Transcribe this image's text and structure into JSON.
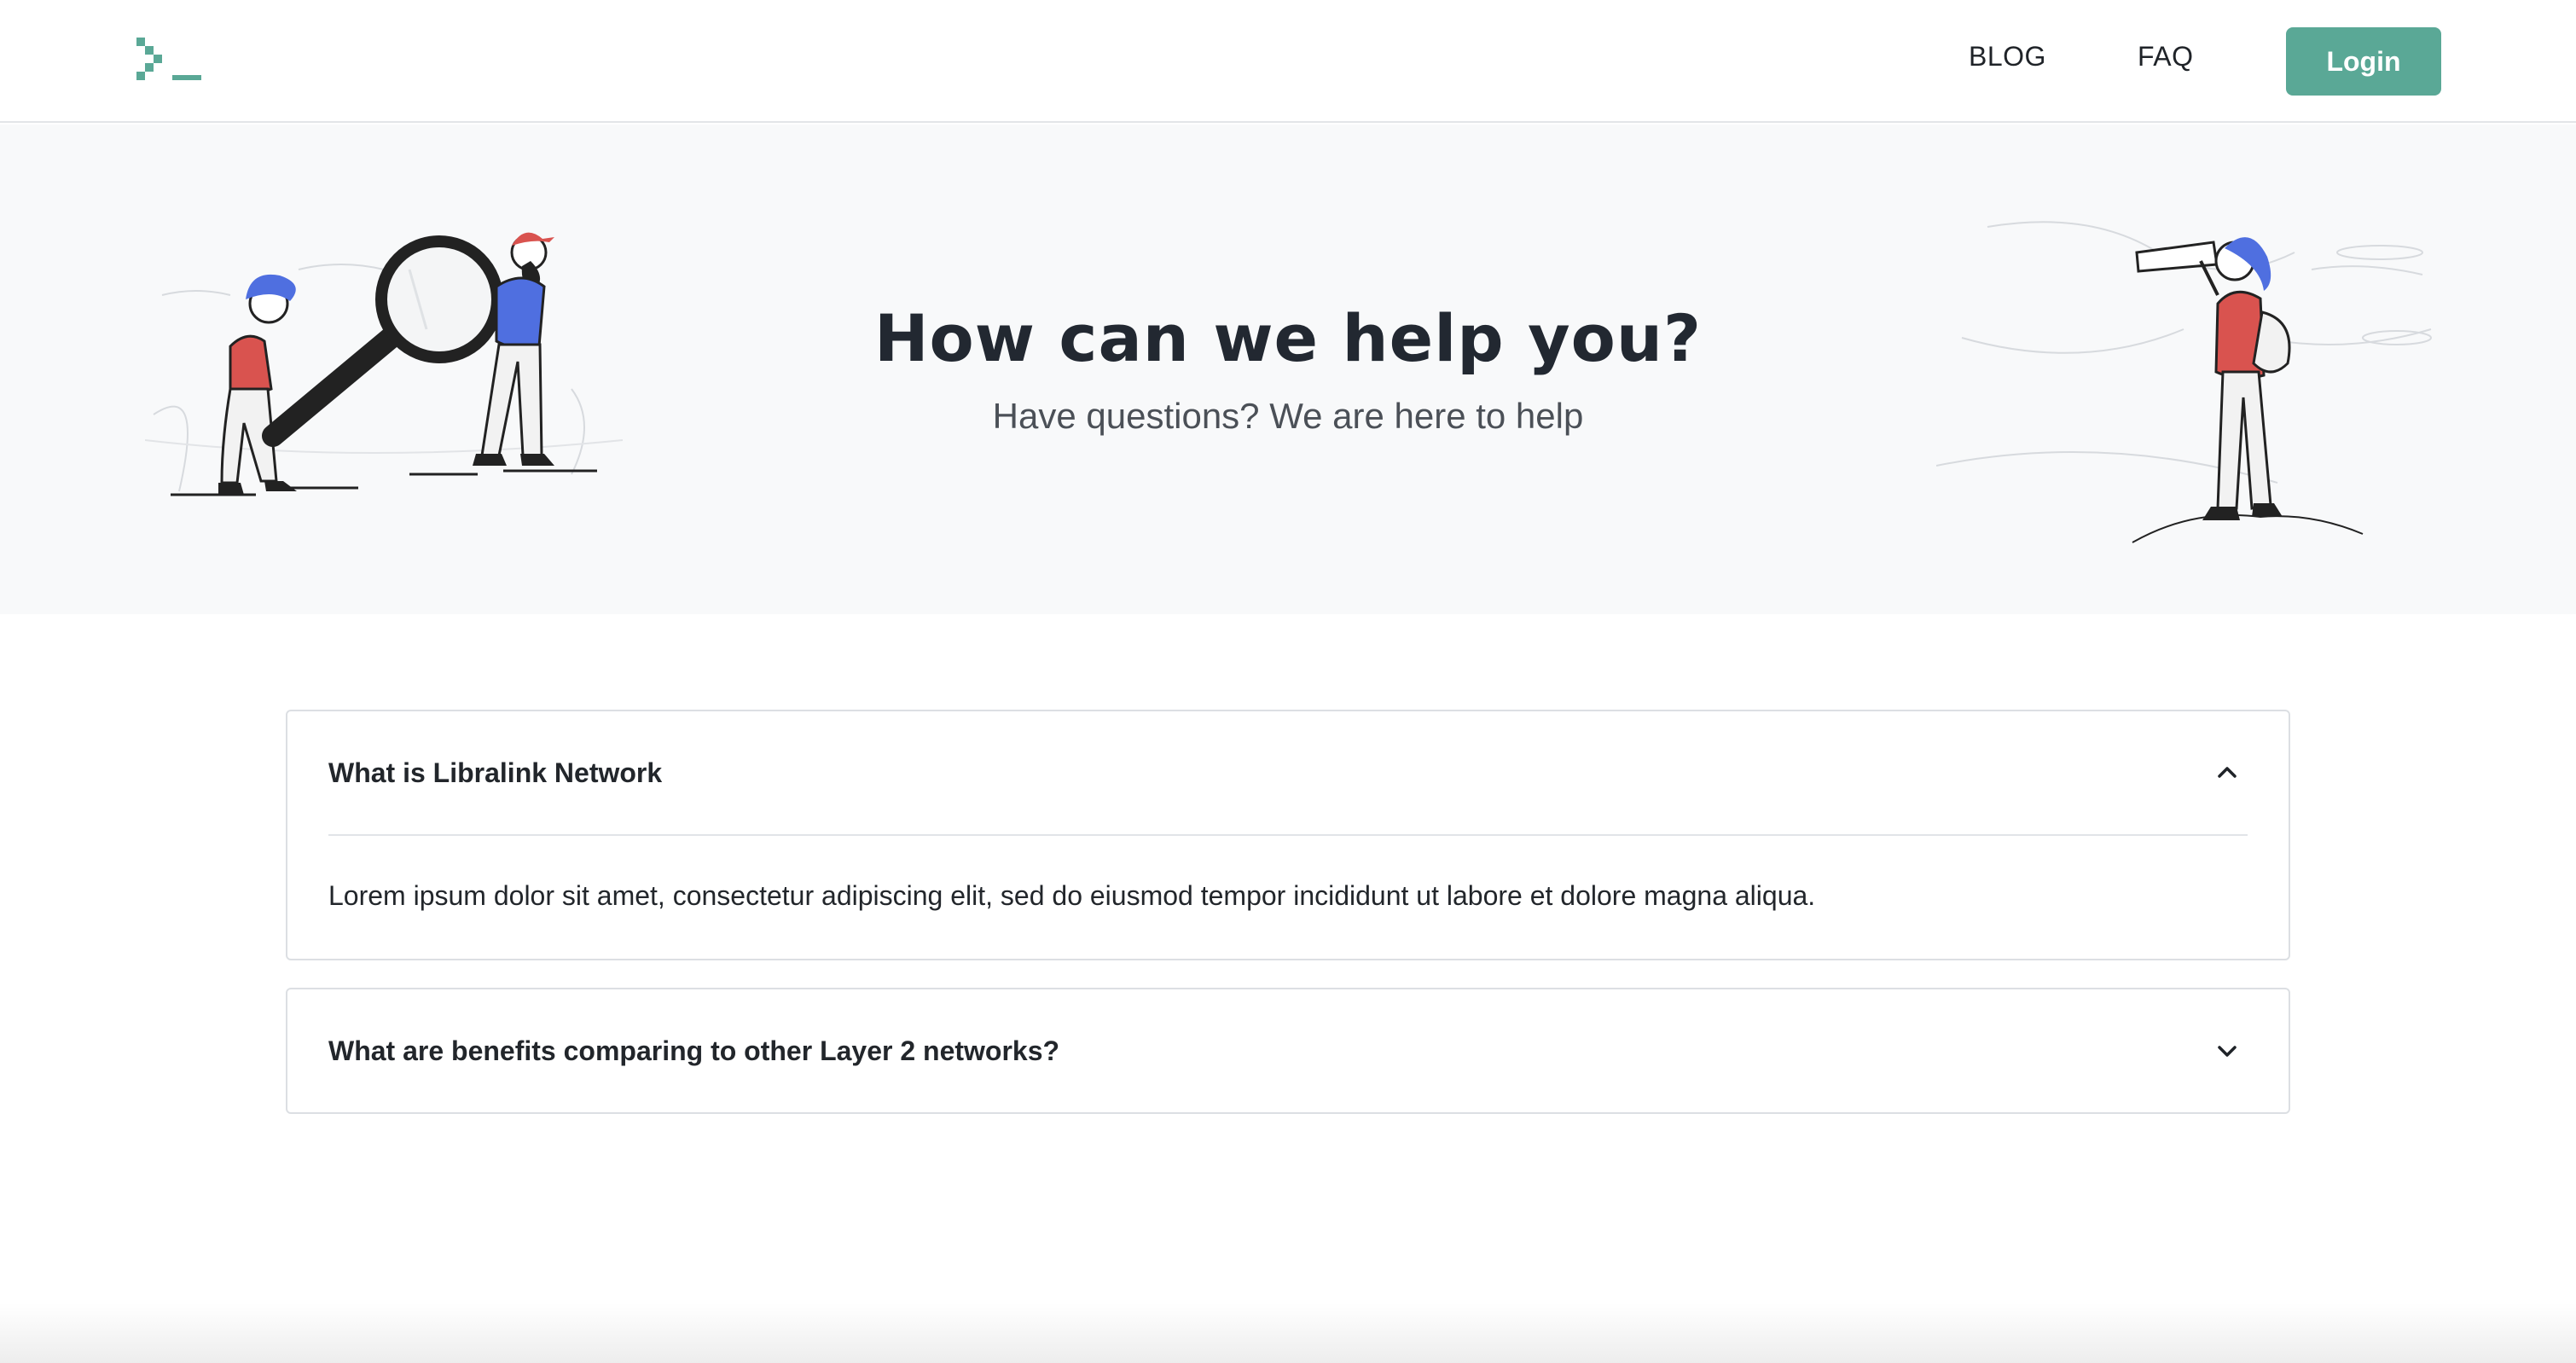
{
  "header": {
    "logo_icon": "terminal-prompt-icon",
    "nav": [
      {
        "label": "BLOG"
      },
      {
        "label": "FAQ"
      }
    ],
    "login_label": "Login",
    "accent_color": "#5aa896"
  },
  "hero": {
    "title": "How can we help you?",
    "subtitle": "Have questions? We are here to help",
    "background": "#f8f9fa"
  },
  "faq": {
    "items": [
      {
        "question": "What is Libralink Network",
        "answer": "Lorem ipsum dolor sit amet, consectetur adipiscing elit, sed do eiusmod tempor incididunt ut labore et dolore magna aliqua.",
        "expanded": true,
        "icon": "chevron-up-icon"
      },
      {
        "question": "What are benefits comparing to other Layer 2 networks?",
        "expanded": false,
        "icon": "chevron-down-icon"
      }
    ]
  }
}
